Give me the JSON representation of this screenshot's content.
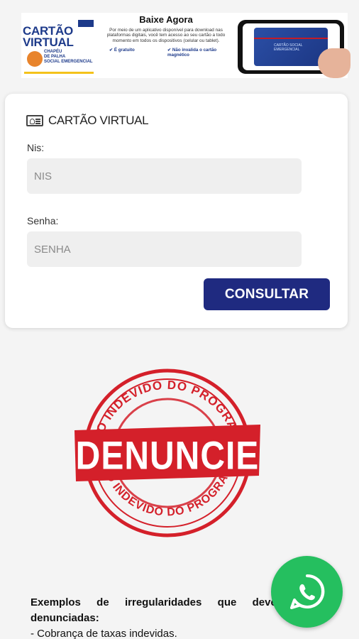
{
  "banner": {
    "logo_line1": "CARTÃO",
    "logo_line2": "VIRTUAL",
    "logo_sub_lines": [
      "CHAPÉU",
      "DE PALHA",
      "SOCIAL EMERGENCIAL"
    ],
    "promo_title": "Baixe Agora",
    "promo_text": "Por meio de um aplicativo disponível para download nas plataformas digitais, você tem acesso ao seu cartão a todo momento em todos os dispositivos (celular ou tablet).",
    "feature_1": "É gratuito",
    "feature_2": "Não invalida o cartão magnético",
    "phone_card_text": "CARTÃO SOCIAL EMERGENCIAL"
  },
  "form": {
    "title": "CARTÃO VIRTUAL",
    "nis_label": "Nis:",
    "nis_placeholder": "NIS",
    "nis_value": "",
    "senha_label": "Senha:",
    "senha_placeholder": "SENHA",
    "senha_value": "",
    "submit_label": "CONSULTAR"
  },
  "stamp": {
    "main_text": "DENUNCIE",
    "arc_top": "USO INDEVIDO DO PROGRAMA",
    "arc_bottom": "USO INDEVIDO DO PROGRAMA"
  },
  "examples": {
    "heading": "Exemplos de irregularidades que devem ser denunciadas:",
    "items": [
      "- Cobrança de taxas indevidas."
    ]
  },
  "whatsapp": {
    "icon": "whatsapp-icon"
  },
  "colors": {
    "brand_blue": "#1f2a80",
    "stamp_red": "#d4202a",
    "whatsapp_green": "#25bf5f"
  }
}
